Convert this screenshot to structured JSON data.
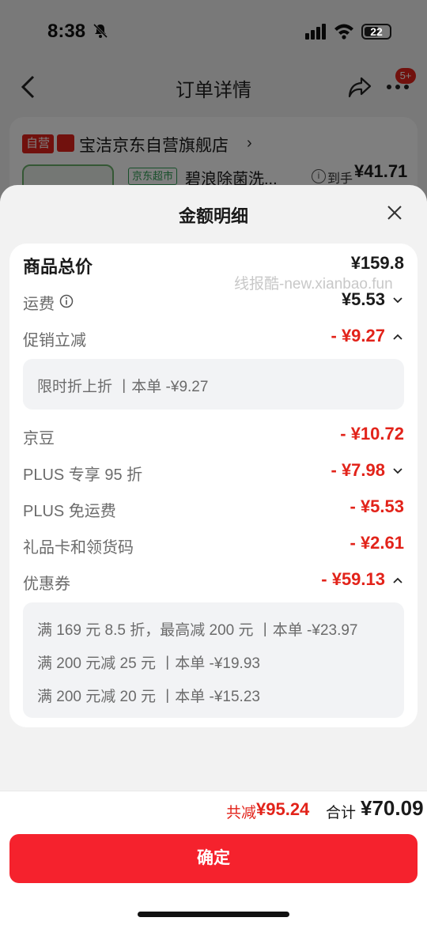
{
  "status_bar": {
    "time": "8:38",
    "battery": "22"
  },
  "nav": {
    "title": "订单详情",
    "badge": "5+"
  },
  "shop": {
    "badge": "自营",
    "name": "宝洁京东自营旗舰店",
    "arrow": "›",
    "market_tag": "京东超市",
    "product_name": "碧浪除菌洗...",
    "price_label": "到手",
    "price": "¥41.71"
  },
  "sheet": {
    "title": "金额明细",
    "watermark": "线报酷-new.xianbao.fun",
    "rows": {
      "goods_total": {
        "label": "商品总价",
        "value": "¥159.8"
      },
      "shipping": {
        "label": "运费",
        "value": "¥5.53"
      },
      "promo": {
        "label": "促销立减",
        "value": "- ¥9.27"
      },
      "promo_detail": "限时折上折 丨本单 -¥9.27",
      "jingdou": {
        "label": "京豆",
        "value": "- ¥10.72"
      },
      "plus95": {
        "label": "PLUS 专享 95 折",
        "value": "- ¥7.98"
      },
      "plus_ship": {
        "label": "PLUS 免运费",
        "value": "- ¥5.53"
      },
      "giftcard": {
        "label": "礼品卡和领货码",
        "value": "- ¥2.61"
      },
      "coupon": {
        "label": "优惠券",
        "value": "- ¥59.13"
      }
    },
    "coupon_details": [
      "满 169 元 8.5 折，最高减 200 元 丨本单 -¥23.97",
      "满 200 元减 25 元 丨本单 -¥19.93",
      "满 200 元减 20 元 丨本单 -¥15.23"
    ]
  },
  "footer": {
    "discount_label": "共减",
    "discount_value": "¥95.24",
    "total_label": "合计",
    "total_value": "¥70.09",
    "confirm_label": "确定"
  },
  "colors": {
    "accent_red": "#e2231a",
    "button_red": "#f5222d"
  }
}
